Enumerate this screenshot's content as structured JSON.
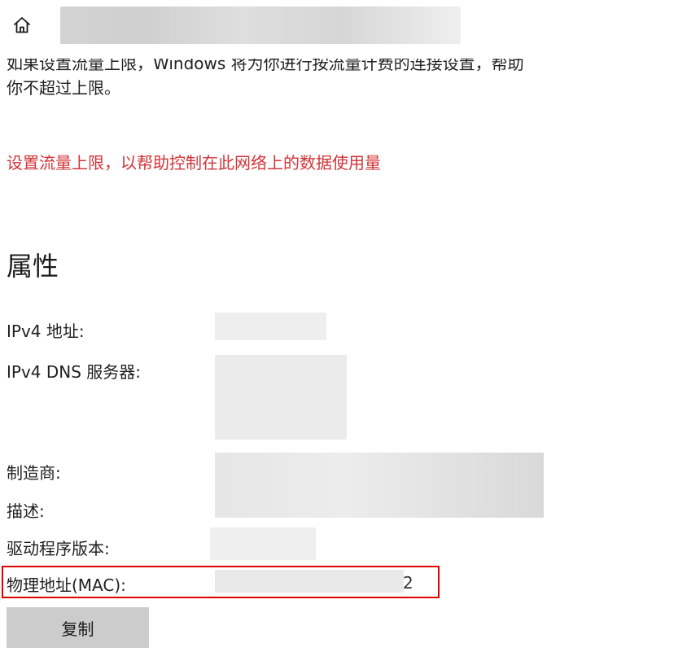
{
  "header": {
    "home_icon": "home-icon",
    "title": ""
  },
  "description": {
    "line1": "如果设置流量上限，Windows 将为你进行按流量计费的连接设置，帮助",
    "line2": "你不超过上限。"
  },
  "limit_link": {
    "label": "设置流量上限，以帮助控制在此网络上的数据使用量",
    "color": "#d13438"
  },
  "properties": {
    "title": "属性",
    "ipv4_address_label": "IPv4 地址:",
    "ipv4_dns_label": "IPv4 DNS 服务器:",
    "manufacturer_label": "制造商:",
    "description_label": "描述:",
    "driver_version_label": "驱动程序版本:",
    "mac_label": "物理地址(MAC):",
    "mac_visible_suffix": "2"
  },
  "copy_button": {
    "label": "复制"
  },
  "highlight_color": "#e00000"
}
